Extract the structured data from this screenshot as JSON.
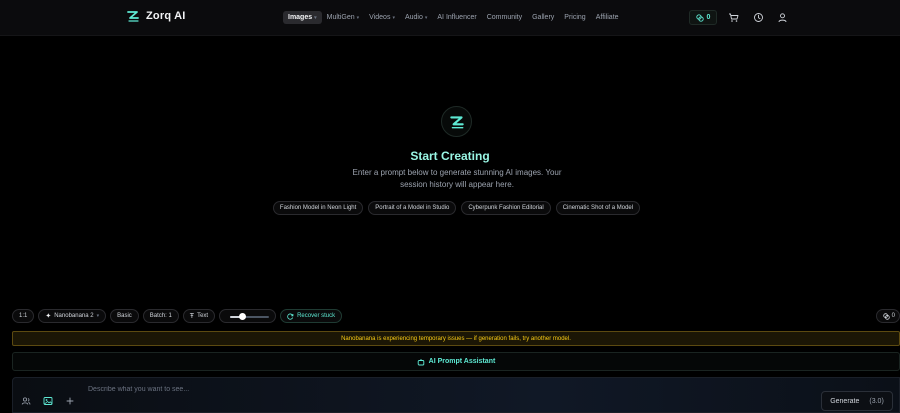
{
  "brand": {
    "name": "Zorq AI",
    "logo_icon": "zorq-logo-icon",
    "accent": "#5eead4"
  },
  "nav": {
    "items": [
      {
        "label": "Images",
        "caret": true,
        "active": true
      },
      {
        "label": "MultiGen",
        "caret": true
      },
      {
        "label": "Videos",
        "caret": true
      },
      {
        "label": "Audio",
        "caret": true
      },
      {
        "label": "AI Influencer"
      },
      {
        "label": "Community"
      },
      {
        "label": "Gallery"
      },
      {
        "label": "Pricing"
      },
      {
        "label": "Affiliate"
      }
    ]
  },
  "header": {
    "credits": {
      "icon": "coins-icon",
      "value": "0"
    },
    "icons": [
      "cart-icon",
      "clock-icon",
      "user-icon"
    ]
  },
  "hero": {
    "title": "Start Creating",
    "subtitle": "Enter a prompt below to generate stunning AI images. Your session history will appear here.",
    "suggestions": [
      "Fashion Model in Neon Light",
      "Portrait of a Model in Studio",
      "Cyberpunk Fashion Editorial",
      "Cinematic Shot of a Model"
    ]
  },
  "toolbar": {
    "aspect": "1:1",
    "model": "Nanobanana 2",
    "mode": "Basic",
    "batch": "Batch: 1",
    "text": "Text",
    "slider_value": 0.3,
    "recover": "Recover stuck",
    "right_count": "0"
  },
  "warning": {
    "text": "Nanobanana is experiencing temporary issues — if generation fails, try another model.",
    "color": "#facc15"
  },
  "assistant": {
    "label": "AI Prompt Assistant",
    "icon": "assistant-icon"
  },
  "prompt": {
    "placeholder": "Describe what you want to see...",
    "value": "",
    "icons": [
      "people-icon",
      "image-icon",
      "plus-icon"
    ],
    "generate_label": "Generate",
    "cost": "(3.0)"
  }
}
